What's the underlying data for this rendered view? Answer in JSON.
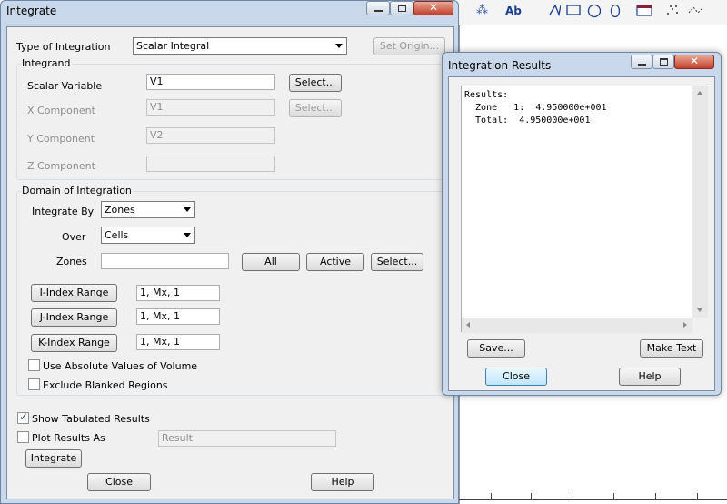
{
  "toolbar": {
    "icons": [
      "probe-icon",
      "text-icon",
      "line-icon",
      "rectangle-icon",
      "circle-icon",
      "ellipse-icon",
      "frame-icon",
      "scatter-icon",
      "polyline-icon"
    ],
    "text_tool_label": "Ab"
  },
  "integrate": {
    "title": "Integrate",
    "type_label": "Type of Integration",
    "type_value": "Scalar Integral",
    "set_origin": "Set Origin...",
    "integrand": {
      "legend": "Integrand",
      "scalar_label": "Scalar Variable",
      "scalar_value": "V1",
      "select_label": "Select...",
      "x_label": "X Component",
      "x_value": "V1",
      "x_select": "Select...",
      "y_label": "Y Component",
      "y_value": "V2",
      "z_label": "Z Component",
      "z_value": ""
    },
    "domain": {
      "legend": "Domain of Integration",
      "by_label": "Integrate By",
      "by_value": "Zones",
      "over_label": "Over",
      "over_value": "Cells",
      "zones_label": "Zones",
      "zones_value": "",
      "all": "All",
      "active": "Active",
      "select": "Select...",
      "i_range": "I-Index Range",
      "i_value": "1, Mx, 1",
      "j_range": "J-Index Range",
      "j_value": "1, Mx, 1",
      "k_range": "K-Index Range",
      "k_value": "1, Mx, 1",
      "abs_label": "Use Absolute Values of Volume",
      "abs_checked": false,
      "blank_label": "Exclude Blanked Regions",
      "blank_checked": false
    },
    "show_tab_label": "Show Tabulated Results",
    "show_tab_checked": true,
    "plot_label": "Plot Results As",
    "plot_checked": false,
    "plot_value": "Result",
    "integrate_button": "Integrate",
    "close_button": "Close",
    "help_button": "Help"
  },
  "results": {
    "title": "Integration Results",
    "lines": [
      "Results:",
      "  Zone   1:  4.950000e+001",
      "  Total:  4.950000e+001"
    ],
    "save_button": "Save...",
    "make_text_button": "Make Text",
    "close_button": "Close",
    "help_button": "Help"
  }
}
